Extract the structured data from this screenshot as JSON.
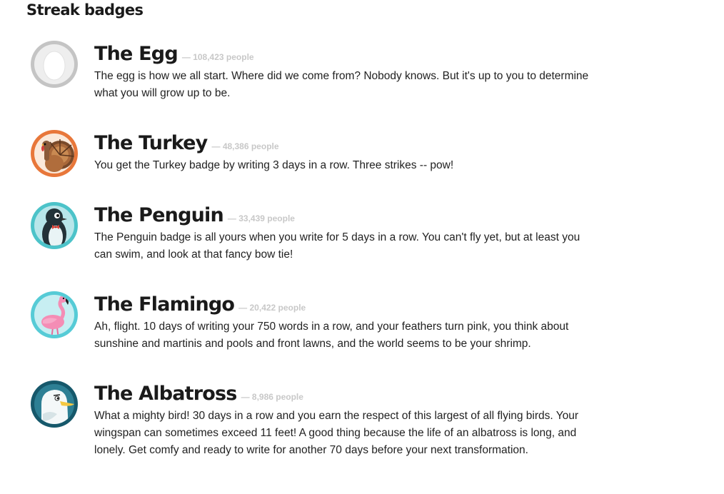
{
  "section": {
    "title": "Streak badges"
  },
  "badges": [
    {
      "name": "The Egg",
      "count": "— 108,423 people",
      "description": "The egg is how we all start. Where did we come from? Nobody knows. But it's up to you to determine what you will grow up to be.",
      "icon": "egg-icon"
    },
    {
      "name": "The Turkey",
      "count": "— 48,386 people",
      "description": "You get the Turkey badge by writing 3 days in a row. Three strikes -- pow!",
      "icon": "turkey-icon"
    },
    {
      "name": "The Penguin",
      "count": "— 33,439 people",
      "description": "The Penguin badge is all yours when you write for 5 days in a row. You can't fly yet, but at least you can swim, and look at that fancy bow tie!",
      "icon": "penguin-icon"
    },
    {
      "name": "The Flamingo",
      "count": "— 20,422 people",
      "description": "Ah, flight. 10 days of writing your 750 words in a row, and your feathers turn pink, you think about sunshine and martinis and pools and front lawns, and the world seems to be your shrimp.",
      "icon": "flamingo-icon"
    },
    {
      "name": "The Albatross",
      "count": "— 8,986 people",
      "description": "What a mighty bird! 30 days in a row and you earn the respect of this largest of all flying birds. Your wingspan can sometimes exceed 11 feet! A good thing because the life of an albatross is long, and lonely. Get comfy and ready to write for another 70 days before your next transformation.",
      "icon": "albatross-icon"
    }
  ],
  "colors": {
    "egg_ring": "#c4c4c4",
    "turkey_ring": "#e8773a",
    "penguin_ring": "#4cc3c9",
    "flamingo_ring": "#56cbd6",
    "albatross_ring": "#16586b",
    "count_text": "#c8c8c8"
  }
}
